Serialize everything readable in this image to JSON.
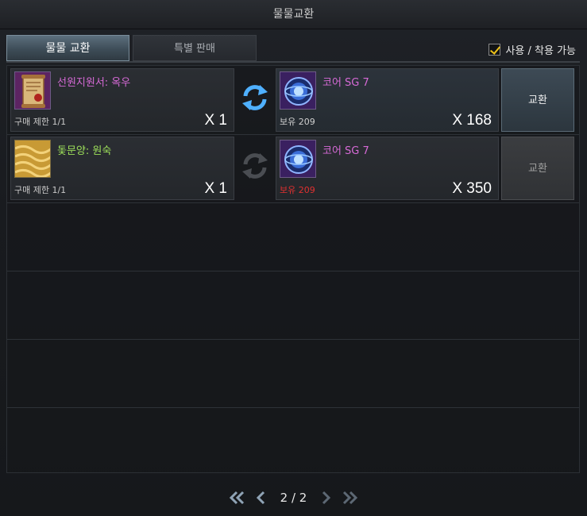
{
  "window": {
    "title": "물물교환"
  },
  "tabs": [
    {
      "label": "물물 교환",
      "active": true
    },
    {
      "label": "특별 판매",
      "active": false
    }
  ],
  "filter": {
    "label": "사용 / 착용 가능",
    "checked": true
  },
  "rows": [
    {
      "item": {
        "name": "선원지원서: 옥우",
        "name_color": "#d66ad6",
        "limit": "구매 제한 1/1",
        "qty": "X 1",
        "icon": "scroll-icon"
      },
      "swap_active": true,
      "cost": {
        "name": "코어 SG 7",
        "name_color": "#d66ad6",
        "owned": "보유 209",
        "owned_color": "#d0d0d0",
        "qty": "X 168",
        "icon": "core-orb-icon"
      },
      "button": {
        "label": "교환",
        "enabled": true
      }
    },
    {
      "item": {
        "name": "돛문양: 원숙",
        "name_color": "#9de05a",
        "limit": "구매 제한 1/1",
        "qty": "X 1",
        "icon": "sail-pattern-icon"
      },
      "swap_active": false,
      "cost": {
        "name": "코어 SG 7",
        "name_color": "#d66ad6",
        "owned": "보유 209",
        "owned_color": "#e03030",
        "qty": "X 350",
        "icon": "core-orb-icon"
      },
      "button": {
        "label": "교환",
        "enabled": false
      }
    }
  ],
  "pager": {
    "label": "2 / 2"
  }
}
